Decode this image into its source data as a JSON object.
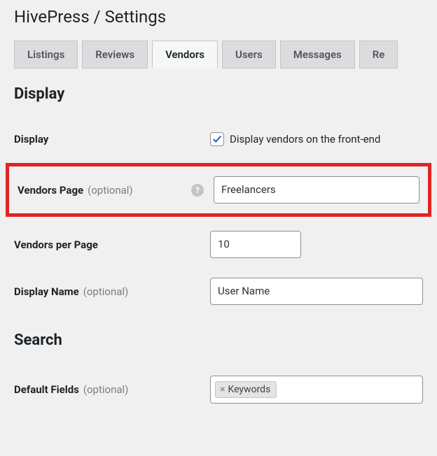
{
  "page": {
    "title": "HivePress / Settings"
  },
  "tabs": {
    "listings": "Listings",
    "reviews": "Reviews",
    "vendors": "Vendors",
    "users": "Users",
    "messages": "Messages",
    "recurring": "Re"
  },
  "sections": {
    "display": "Display",
    "search": "Search"
  },
  "fields": {
    "display": {
      "label": "Display",
      "checkbox_label": "Display vendors on the front-end",
      "checked": true
    },
    "vendors_page": {
      "label": "Vendors Page",
      "optional": "(optional)",
      "value": "Freelancers"
    },
    "vendors_per_page": {
      "label": "Vendors per Page",
      "value": "10"
    },
    "display_name": {
      "label": "Display Name",
      "optional": "(optional)",
      "value": "User Name"
    },
    "default_fields": {
      "label": "Default Fields",
      "optional": "(optional)",
      "tag": "Keywords"
    }
  }
}
